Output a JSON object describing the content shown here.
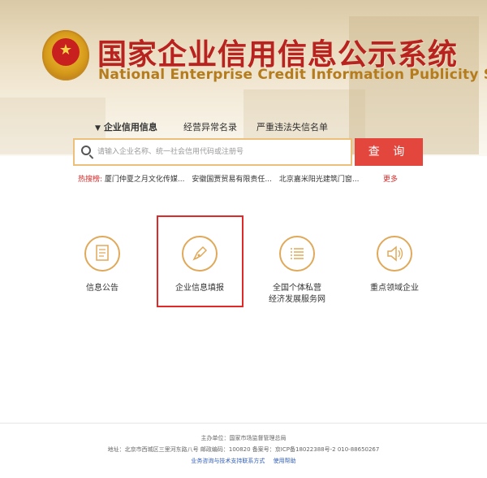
{
  "header": {
    "title_cn": "国家企业信用信息公示系统",
    "title_en": "National Enterprise Credit Information Publicity System"
  },
  "tabs": [
    {
      "label": "企业信用信息",
      "active": true
    },
    {
      "label": "经营异常名录",
      "active": false
    },
    {
      "label": "严重违法失信名单",
      "active": false
    }
  ],
  "search": {
    "placeholder": "请输入企业名称、统一社会信用代码或注册号",
    "button_label": "查 询"
  },
  "hot": {
    "label": "热搜榜:",
    "items": [
      "厦门仲夏之月文化传媒...",
      "安徽国贾贸易有限责任...",
      "北京嘉米阳光建筑门窗..."
    ],
    "more": "更多"
  },
  "services": [
    {
      "label": "信息公告",
      "icon": "document-icon"
    },
    {
      "label": "企业信息填报",
      "icon": "pen-icon"
    },
    {
      "label_line1": "全国个体私营",
      "label_line2": "经济发展服务网",
      "icon": "list-icon"
    },
    {
      "label": "重点领域企业",
      "icon": "speaker-icon"
    }
  ],
  "footer": {
    "line1": "主办单位：国家市场监督管理总局",
    "line2": "地址：北京市西城区三里河东路八号  邮政编码：100820  备案号：京ICP备18022388号-2  010-88650267",
    "link1": "业务咨询与技术支持联系方式",
    "link2": "使用帮助"
  },
  "colors": {
    "brand_red": "#b8221f",
    "search_button": "#e2463d",
    "icon_gold": "#e0a95a"
  }
}
